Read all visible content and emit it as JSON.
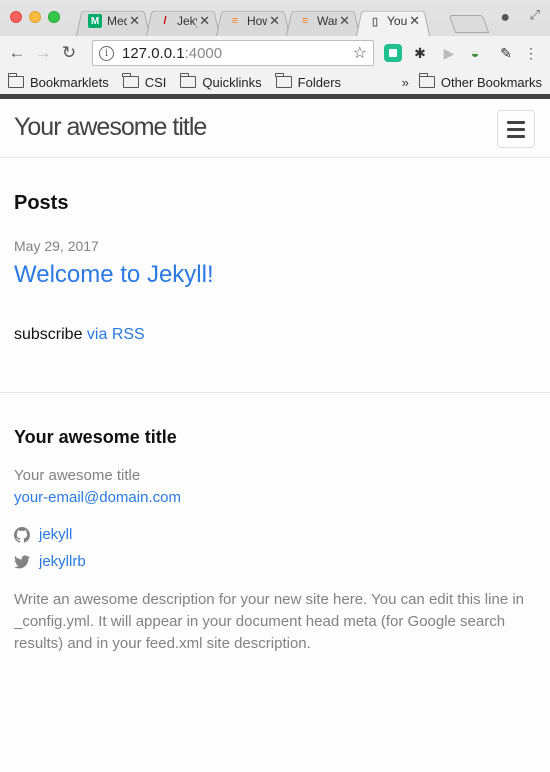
{
  "browser": {
    "tabs": [
      {
        "title": "Med",
        "favicon": "medium-icon",
        "active": false
      },
      {
        "title": "Jeky",
        "favicon": "jekyll-icon",
        "active": false
      },
      {
        "title": "How",
        "favicon": "stackoverflow-icon",
        "active": false
      },
      {
        "title": "War",
        "favicon": "stackoverflow-icon",
        "active": false
      },
      {
        "title": "You",
        "favicon": "document-icon",
        "active": true
      }
    ],
    "url_host": "127.0.0.1",
    "url_port": ":4000",
    "bookmarks": [
      "Bookmarklets",
      "CSI",
      "Quicklinks",
      "Folders"
    ],
    "other_bookmarks": "Other Bookmarks"
  },
  "site": {
    "title": "Your awesome title"
  },
  "posts": {
    "heading": "Posts",
    "items": [
      {
        "date": "May 29, 2017",
        "title": "Welcome to Jekyll!"
      }
    ],
    "subscribe_text": "subscribe ",
    "subscribe_link": "via RSS"
  },
  "footer": {
    "heading": "Your awesome title",
    "name": "Your awesome title",
    "email": "your-email@domain.com",
    "github": "jekyll",
    "twitter": "jekyllrb",
    "description": "Write an awesome description for your new site here. You can edit this line in _config.yml. It will appear in your document head meta (for Google search results) and in your feed.xml site description."
  }
}
